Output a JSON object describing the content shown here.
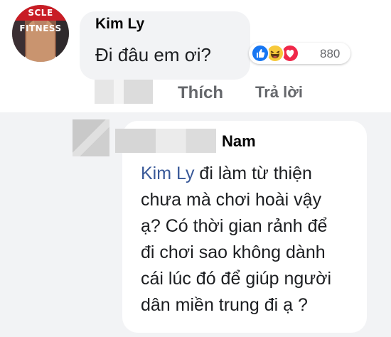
{
  "comment": {
    "author": "Kim Ly",
    "text": "Đi đâu em ơi?",
    "avatar": {
      "masthead": "SCLE FITNESS"
    },
    "reactions": {
      "icons": [
        "like-icon",
        "haha-icon",
        "love-icon"
      ],
      "count": "880",
      "colors": {
        "like": "#1877f2",
        "haha": "#f7c93b",
        "love": "#f02849"
      }
    },
    "actions": {
      "like_label": "Thích",
      "reply_label": "Trả lời"
    }
  },
  "reply": {
    "author_visible": "Nam",
    "mention": "Kim Ly",
    "text_lines": [
      " đi làm từ thiện",
      "chưa mà chơi hoài vậy",
      "ạ? Có thời gian rảnh để",
      "đi chơi sao không dành",
      "cái lúc đó để giúp người",
      "dân miền trung đi ạ ?"
    ]
  },
  "colors": {
    "mention": "#385898",
    "muted_text": "#65676b",
    "bubble_bg": "#f2f3f5"
  }
}
